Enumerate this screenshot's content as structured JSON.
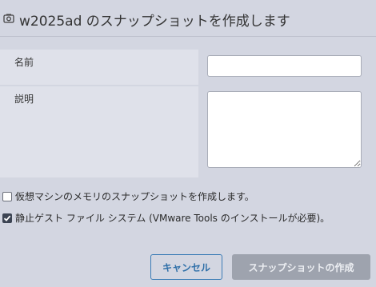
{
  "dialog": {
    "title": "w2025ad のスナップショットを作成します",
    "title_icon": "camera-icon"
  },
  "form": {
    "name_label": "名前",
    "name_value": "",
    "description_label": "説明",
    "description_value": ""
  },
  "options": {
    "memory_label": "仮想マシンのメモリのスナップショットを作成します。",
    "memory_checked": false,
    "quiesce_label": "静止ゲスト ファイル システム (VMware Tools のインストールが必要)。",
    "quiesce_checked": true
  },
  "buttons": {
    "cancel_label": "キャンセル",
    "create_label": "スナップショットの作成"
  },
  "colors": {
    "accent": "#2f6fa8",
    "disabled_button": "#9ea3ae"
  }
}
